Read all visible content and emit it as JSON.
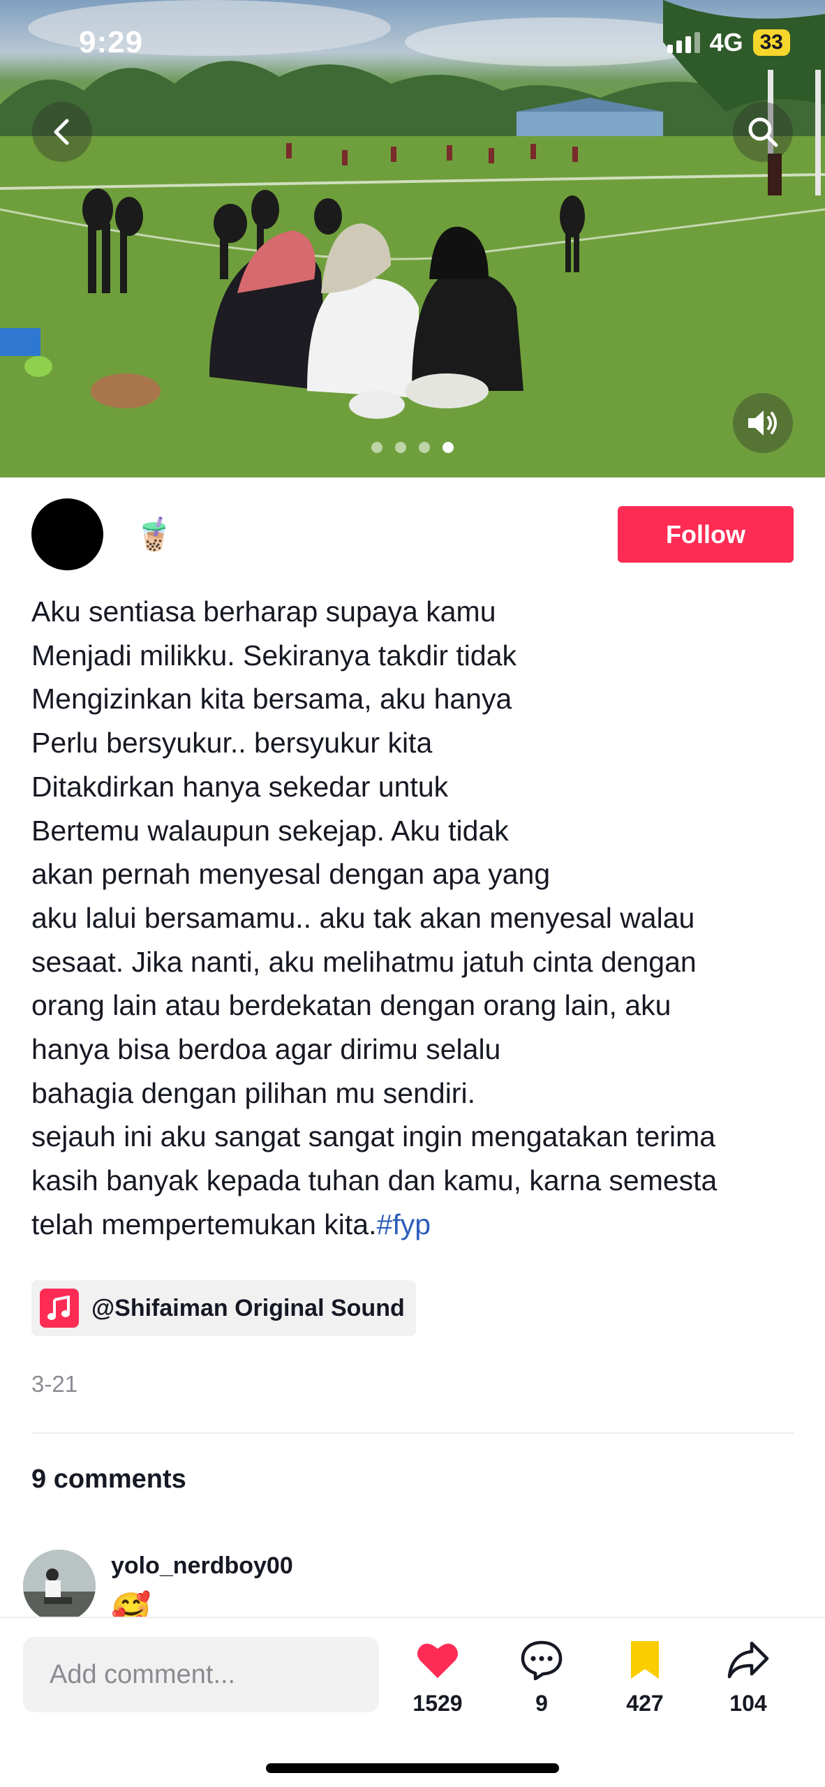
{
  "status_bar": {
    "time": "9:29",
    "network": "4G",
    "battery": "33"
  },
  "media": {
    "icons": [
      "back-arrow-icon",
      "search-icon",
      "speaker-icon"
    ],
    "pages": 4,
    "active_page": 4
  },
  "author": {
    "name": "🧋",
    "follow_label": "Follow"
  },
  "caption": {
    "lines": [
      "Aku sentiasa berharap supaya kamu",
      "Menjadi milikku. Sekiranya takdir tidak",
      "Mengizinkan kita bersama, aku hanya",
      "Perlu bersyukur.. bersyukur kita",
      "Ditakdirkan hanya sekedar untuk",
      "Bertemu walaupun sekejap. Aku tidak",
      "akan pernah menyesal dengan apa yang",
      "aku lalui bersamamu.. aku tak akan menyesal walau",
      "sesaat. Jika nanti, aku melihatmu jatuh cinta dengan",
      "orang lain atau berdekatan dengan orang lain, aku",
      "hanya bisa berdoa agar dirimu selalu",
      "bahagia dengan pilihan mu sendiri.",
      "sejauh ini aku sangat sangat ingin mengatakan terima",
      "kasih banyak kepada tuhan dan kamu, karna semesta"
    ],
    "last_line": "telah mempertemukan kita.",
    "hashtag": "#fyp"
  },
  "sound": {
    "label": "@Shifaiman Original Sound"
  },
  "date": "3-21",
  "comments": {
    "count_label": "9 comments",
    "items": [
      {
        "username": "yolo_nerdboy00",
        "text": "🥰"
      }
    ]
  },
  "bottom_bar": {
    "placeholder": "Add comment...",
    "likes": "1529",
    "comments": "9",
    "favorites": "427",
    "shares": "104"
  },
  "colors": {
    "accent": "#fe2c55",
    "hashtag": "#2b5db9",
    "favorite": "#facd00"
  }
}
